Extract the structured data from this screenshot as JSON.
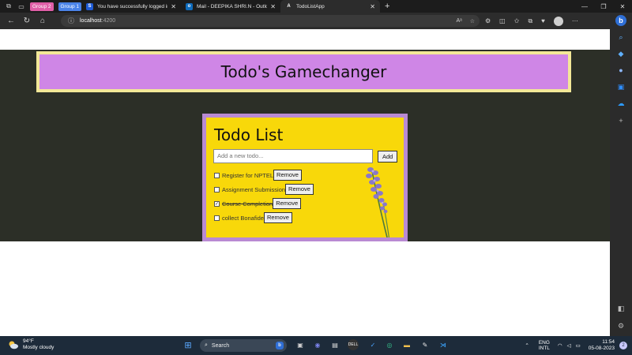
{
  "browser": {
    "tab_groups": [
      {
        "label": "Group 2",
        "color": "#e05fa7"
      },
      {
        "label": "Group 1",
        "color": "#4a83e8"
      }
    ],
    "tabs": [
      {
        "title": "You have successfully logged in.",
        "favicon": "S",
        "favicon_color": "#1e5bd6",
        "active": false
      },
      {
        "title": "Mail - DEEPIKA SHRI.N - Outlook",
        "favicon": "o",
        "favicon_color": "#0f6cbd",
        "active": false
      },
      {
        "title": "TodoListApp",
        "favicon": "A",
        "favicon_color": "#2c2c2c",
        "active": true
      }
    ],
    "url_host": "localhost",
    "url_port": ":4200"
  },
  "page": {
    "banner_title": "Todo's Gamechanger",
    "card_title": "Todo List",
    "input_placeholder": "Add a new todo...",
    "add_label": "Add",
    "todos": [
      {
        "text": "Register for NPTEL",
        "checked": false,
        "remove_label": "Remove"
      },
      {
        "text": "Assignment Submission",
        "checked": false,
        "remove_label": "Remove"
      },
      {
        "text": "Course Completion",
        "checked": true,
        "remove_label": "Remove"
      },
      {
        "text": "collect Bonafide",
        "checked": false,
        "remove_label": "Remove"
      }
    ],
    "colors": {
      "banner_bg": "#cf86e6",
      "banner_border": "#f3e897",
      "card_bg": "#f8d80a",
      "card_border": "#b98ad3",
      "band": "#2c2f27"
    }
  },
  "taskbar": {
    "weather_temp": "94°F",
    "weather_desc": "Mostly cloudy",
    "search_label": "Search",
    "lang_line1": "ENG",
    "lang_line2": "INTL",
    "time": "11:54",
    "date": "05-08-2023",
    "notification_count": "2"
  }
}
